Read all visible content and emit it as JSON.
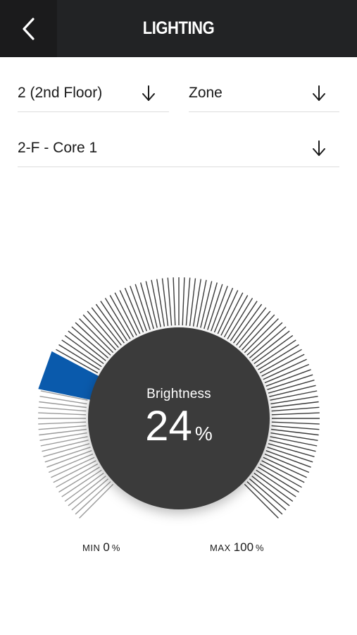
{
  "header": {
    "title": "LIGHTING",
    "back_icon": "chevron-left-icon"
  },
  "selectors": {
    "floor": {
      "value": "2 (2nd Floor)",
      "icon": "arrow-down-icon"
    },
    "zone": {
      "value": "Zone",
      "icon": "arrow-down-icon"
    },
    "area": {
      "value": "2-F - Core 1",
      "icon": "arrow-down-icon"
    }
  },
  "dial": {
    "label": "Brightness",
    "value": "24",
    "unit": "%",
    "level_percent": 24,
    "min": {
      "caption": "MIN",
      "value": "0",
      "unit": "%"
    },
    "max": {
      "caption": "MAX",
      "value": "100",
      "unit": "%"
    },
    "colors": {
      "knob": "#3a3a3a",
      "handle": "#0a5aac",
      "tick_active": "#9a9a9a",
      "tick_inactive": "#3a3a3a"
    }
  }
}
